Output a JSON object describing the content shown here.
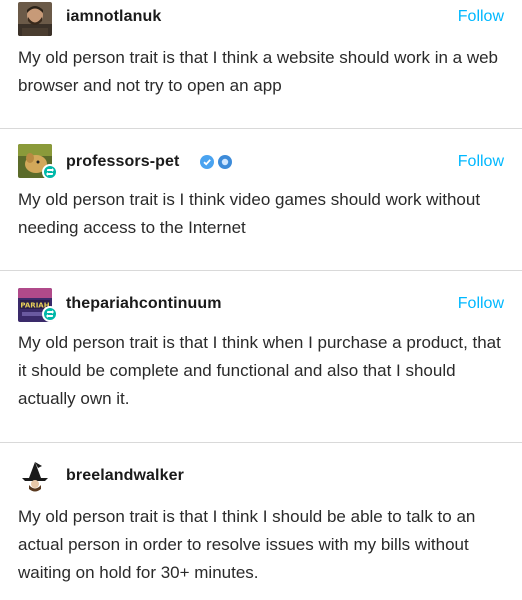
{
  "posts": [
    {
      "username": "iamnotlanuk",
      "follow_label": "Follow",
      "avatar_icon": "man-photo-avatar",
      "verified": false,
      "text": "My old person trait is that I think a website should work in a web browser and not try to open an app"
    },
    {
      "username": "professors-pet",
      "follow_label": "Follow",
      "avatar_icon": "dog-photo-avatar",
      "verified": true,
      "badge_colors": [
        "#4aa3f0",
        "#3d8bd9"
      ],
      "text": "My old person trait is I think video games should work without needing access to the Internet"
    },
    {
      "username": "thepariahcontinuum",
      "follow_label": "Follow",
      "avatar_icon": "pariah-logo-avatar",
      "verified": false,
      "text": "My old person trait is that I think when I purchase a product, that it should be complete and functional and also that I should actually own it."
    },
    {
      "username": "breelandwalker",
      "avatar_icon": "witch-hat-avatar",
      "verified": false,
      "text": "My old person trait is that I think I should be able to talk to an actual person in order to resolve issues with my bills without waiting on hold for 30+ minutes."
    }
  ],
  "colors": {
    "follow": "#00b8ff",
    "reblog_badge": "#00b8a9",
    "divider": "#d9d9d9"
  }
}
